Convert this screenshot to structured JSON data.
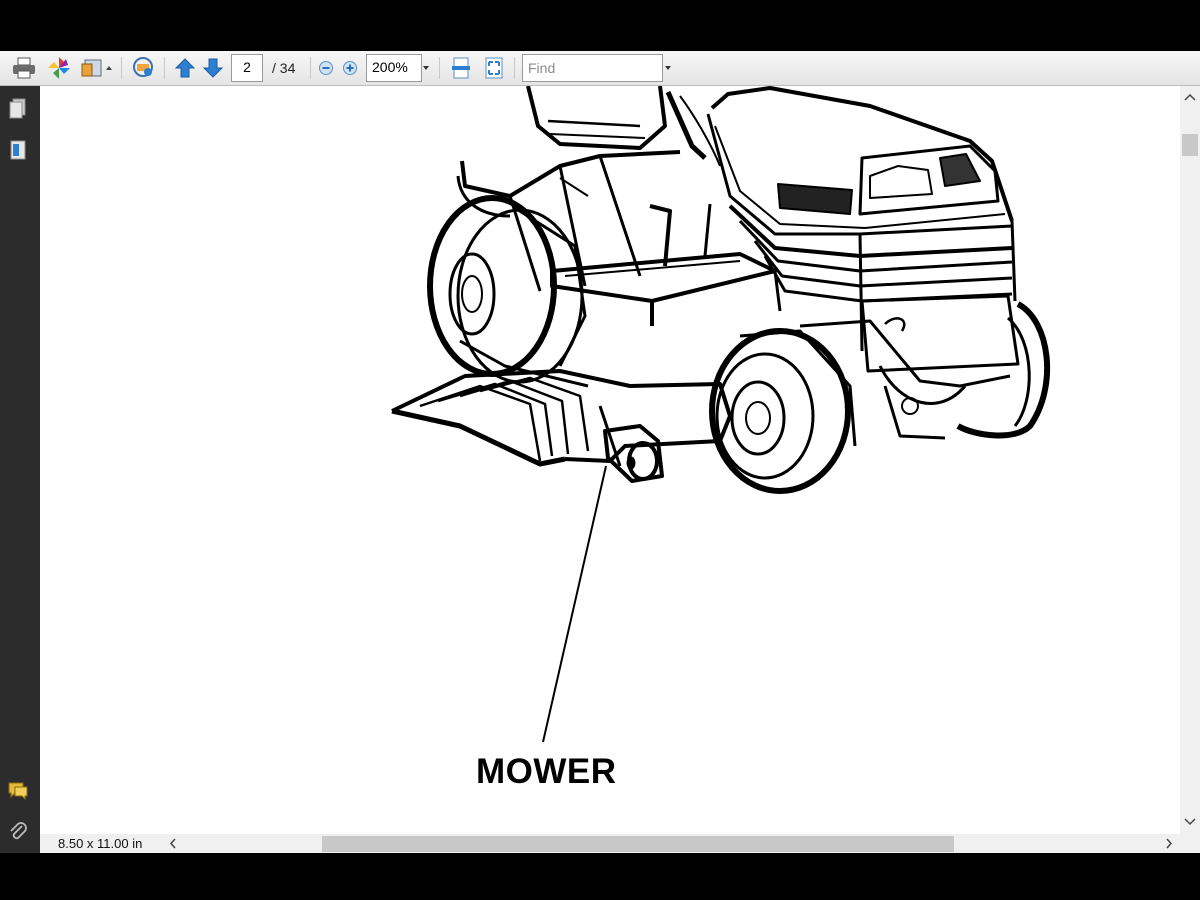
{
  "toolbar": {
    "icons": [
      "print-icon",
      "pinwheel-icon",
      "share-icon",
      "chat-bubble-icon",
      "arrow-up-icon",
      "arrow-down-icon",
      "zoom-out-icon",
      "zoom-in-icon",
      "fit-width-icon",
      "fit-page-icon"
    ],
    "page_current": "2",
    "page_total": "/ 34",
    "zoom": "200%",
    "find_placeholder": "Find"
  },
  "sidebar": {
    "icons": [
      "pages-icon",
      "bookmarks-icon",
      "comments-icon",
      "attachment-icon"
    ]
  },
  "document": {
    "callout_label": "MOWER"
  },
  "status": {
    "page_size": "8.50 x 11.00 in"
  },
  "colors": {
    "toolbar_bg": "#ececec",
    "sidebar_bg": "#2c2c2c",
    "arrow_blue": "#2d7fd1",
    "frame": "#000000"
  }
}
